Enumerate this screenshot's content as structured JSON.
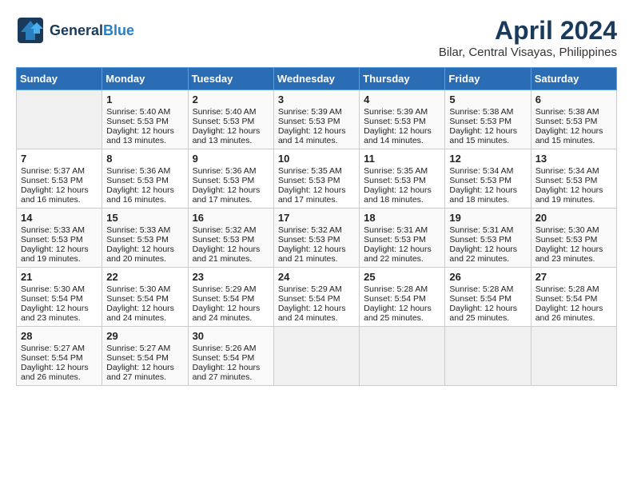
{
  "header": {
    "logo_general": "General",
    "logo_blue": "Blue",
    "title": "April 2024",
    "subtitle": "Bilar, Central Visayas, Philippines"
  },
  "calendar": {
    "weekdays": [
      "Sunday",
      "Monday",
      "Tuesday",
      "Wednesday",
      "Thursday",
      "Friday",
      "Saturday"
    ],
    "weeks": [
      [
        {
          "day": "",
          "empty": true
        },
        {
          "day": "1",
          "sunrise": "5:40 AM",
          "sunset": "5:53 PM",
          "daylight": "12 hours and 13 minutes."
        },
        {
          "day": "2",
          "sunrise": "5:40 AM",
          "sunset": "5:53 PM",
          "daylight": "12 hours and 13 minutes."
        },
        {
          "day": "3",
          "sunrise": "5:39 AM",
          "sunset": "5:53 PM",
          "daylight": "12 hours and 14 minutes."
        },
        {
          "day": "4",
          "sunrise": "5:39 AM",
          "sunset": "5:53 PM",
          "daylight": "12 hours and 14 minutes."
        },
        {
          "day": "5",
          "sunrise": "5:38 AM",
          "sunset": "5:53 PM",
          "daylight": "12 hours and 15 minutes."
        },
        {
          "day": "6",
          "sunrise": "5:38 AM",
          "sunset": "5:53 PM",
          "daylight": "12 hours and 15 minutes."
        }
      ],
      [
        {
          "day": "7",
          "sunrise": "5:37 AM",
          "sunset": "5:53 PM",
          "daylight": "12 hours and 16 minutes."
        },
        {
          "day": "8",
          "sunrise": "5:36 AM",
          "sunset": "5:53 PM",
          "daylight": "12 hours and 16 minutes."
        },
        {
          "day": "9",
          "sunrise": "5:36 AM",
          "sunset": "5:53 PM",
          "daylight": "12 hours and 17 minutes."
        },
        {
          "day": "10",
          "sunrise": "5:35 AM",
          "sunset": "5:53 PM",
          "daylight": "12 hours and 17 minutes."
        },
        {
          "day": "11",
          "sunrise": "5:35 AM",
          "sunset": "5:53 PM",
          "daylight": "12 hours and 18 minutes."
        },
        {
          "day": "12",
          "sunrise": "5:34 AM",
          "sunset": "5:53 PM",
          "daylight": "12 hours and 18 minutes."
        },
        {
          "day": "13",
          "sunrise": "5:34 AM",
          "sunset": "5:53 PM",
          "daylight": "12 hours and 19 minutes."
        }
      ],
      [
        {
          "day": "14",
          "sunrise": "5:33 AM",
          "sunset": "5:53 PM",
          "daylight": "12 hours and 19 minutes."
        },
        {
          "day": "15",
          "sunrise": "5:33 AM",
          "sunset": "5:53 PM",
          "daylight": "12 hours and 20 minutes."
        },
        {
          "day": "16",
          "sunrise": "5:32 AM",
          "sunset": "5:53 PM",
          "daylight": "12 hours and 21 minutes."
        },
        {
          "day": "17",
          "sunrise": "5:32 AM",
          "sunset": "5:53 PM",
          "daylight": "12 hours and 21 minutes."
        },
        {
          "day": "18",
          "sunrise": "5:31 AM",
          "sunset": "5:53 PM",
          "daylight": "12 hours and 22 minutes."
        },
        {
          "day": "19",
          "sunrise": "5:31 AM",
          "sunset": "5:53 PM",
          "daylight": "12 hours and 22 minutes."
        },
        {
          "day": "20",
          "sunrise": "5:30 AM",
          "sunset": "5:53 PM",
          "daylight": "12 hours and 23 minutes."
        }
      ],
      [
        {
          "day": "21",
          "sunrise": "5:30 AM",
          "sunset": "5:54 PM",
          "daylight": "12 hours and 23 minutes."
        },
        {
          "day": "22",
          "sunrise": "5:30 AM",
          "sunset": "5:54 PM",
          "daylight": "12 hours and 24 minutes."
        },
        {
          "day": "23",
          "sunrise": "5:29 AM",
          "sunset": "5:54 PM",
          "daylight": "12 hours and 24 minutes."
        },
        {
          "day": "24",
          "sunrise": "5:29 AM",
          "sunset": "5:54 PM",
          "daylight": "12 hours and 24 minutes."
        },
        {
          "day": "25",
          "sunrise": "5:28 AM",
          "sunset": "5:54 PM",
          "daylight": "12 hours and 25 minutes."
        },
        {
          "day": "26",
          "sunrise": "5:28 AM",
          "sunset": "5:54 PM",
          "daylight": "12 hours and 25 minutes."
        },
        {
          "day": "27",
          "sunrise": "5:28 AM",
          "sunset": "5:54 PM",
          "daylight": "12 hours and 26 minutes."
        }
      ],
      [
        {
          "day": "28",
          "sunrise": "5:27 AM",
          "sunset": "5:54 PM",
          "daylight": "12 hours and 26 minutes."
        },
        {
          "day": "29",
          "sunrise": "5:27 AM",
          "sunset": "5:54 PM",
          "daylight": "12 hours and 27 minutes."
        },
        {
          "day": "30",
          "sunrise": "5:26 AM",
          "sunset": "5:54 PM",
          "daylight": "12 hours and 27 minutes."
        },
        {
          "day": "",
          "empty": true
        },
        {
          "day": "",
          "empty": true
        },
        {
          "day": "",
          "empty": true
        },
        {
          "day": "",
          "empty": true
        }
      ]
    ]
  }
}
